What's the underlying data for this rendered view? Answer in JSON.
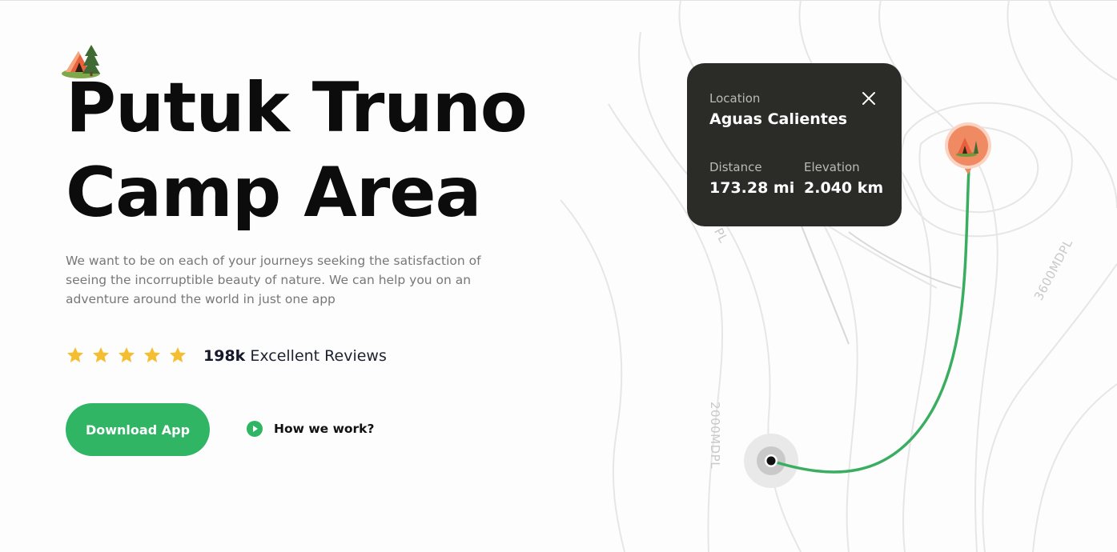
{
  "hero": {
    "title_line1": "Putuk Truno",
    "title_line2": "Camp Area",
    "description": "We want to be on each of your journeys seeking the satisfaction of seeing the incorruptible beauty of nature. We can help you on an adventure around the world in just one app",
    "icon": "camping-tent-icon"
  },
  "rating": {
    "stars": 5,
    "count": "198k",
    "label": "Excellent Reviews",
    "star_color": "#f5bd2f"
  },
  "actions": {
    "download_label": "Download App",
    "how_label": "How we work?",
    "accent": "#2fb563"
  },
  "card": {
    "location_label": "Location",
    "location_value": "Aguas Calientes",
    "distance_label": "Distance",
    "distance_value": "173.28 mi",
    "elevation_label": "Elevation",
    "elevation_value": "2.040 km",
    "close_icon": "close-icon",
    "background": "#2b2c28"
  },
  "map": {
    "contour_labels": [
      "3600MDPL",
      "2000MDPL",
      "PL"
    ],
    "route_color": "#3aae60",
    "destination_pin_color": "#f08a63"
  }
}
